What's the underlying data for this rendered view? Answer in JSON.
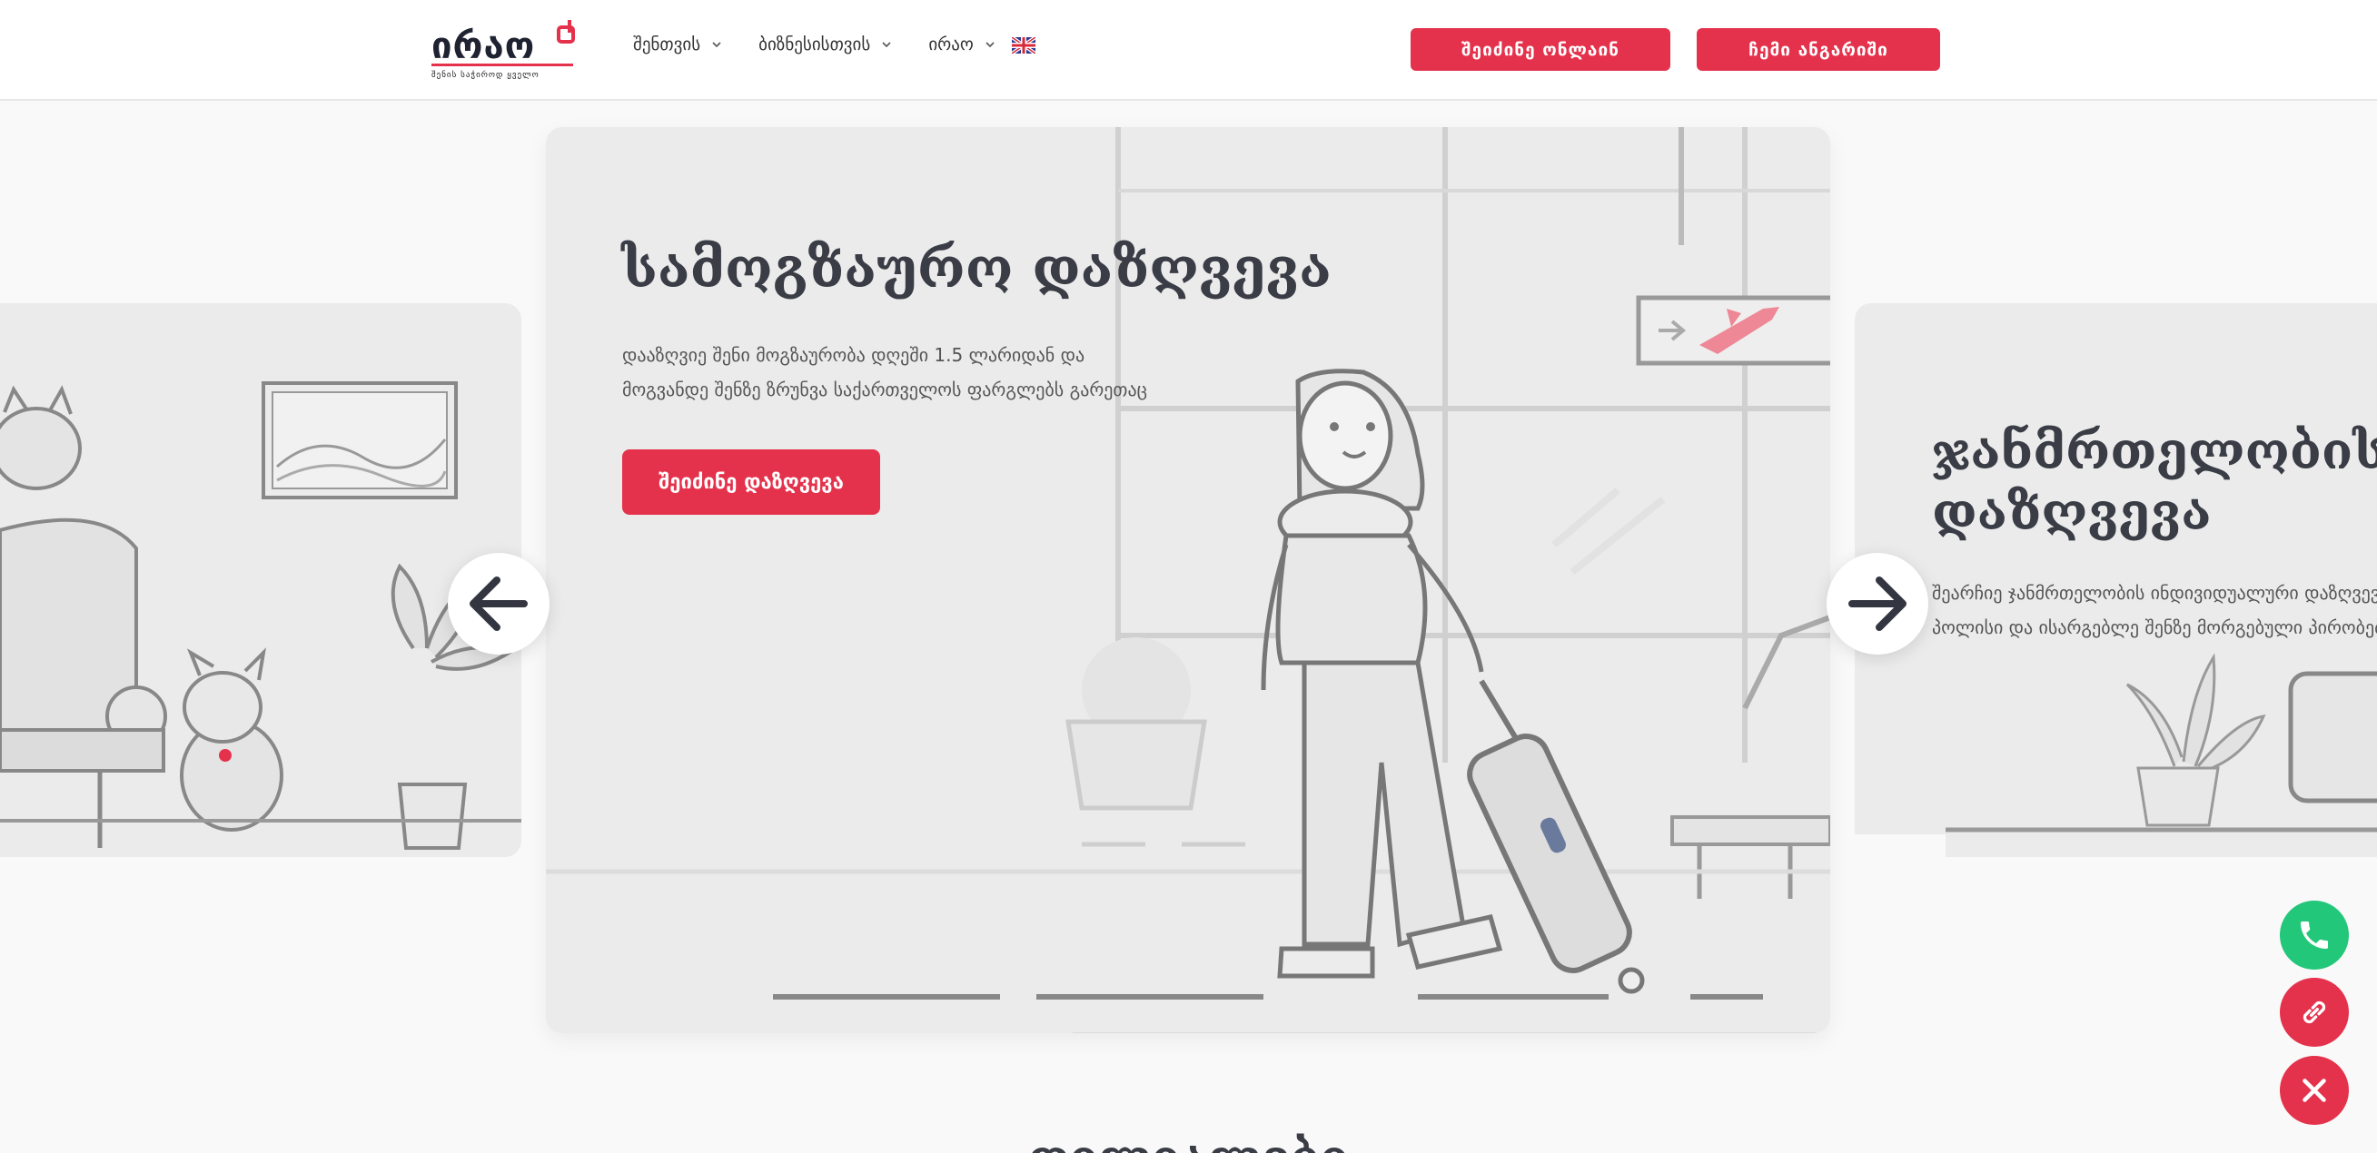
{
  "header": {
    "logo_text": "ირაო",
    "logo_tagline": "შენის საჭიროდ ყველო",
    "nav": [
      {
        "label": "შენთვის"
      },
      {
        "label": "ბიზნესისთვის"
      },
      {
        "label": "ირაო"
      }
    ],
    "language_flag": "uk-flag-icon",
    "buy_online_label": "შეიძინე ონლაინ",
    "my_account_label": "ჩემი ანგარიში"
  },
  "slides": {
    "prev": {
      "illustration": "living-room-with-cat-and-dog"
    },
    "current": {
      "title": "სამოგზაურო დაზღვევა",
      "text_line1": "დააზღვიე შენი მოგზაურობა დღეში 1.5 ლარიდან და",
      "text_line2": "მოგვანდე შენზე ზრუნვა საქართველოს ფარგლებს გარეთაც",
      "cta_label": "შეიძინე დაზღვევა",
      "illustration": "traveler-with-suitcase"
    },
    "next": {
      "title_line1": "ჯანმრთელობის",
      "title_line2": "დაზღვევა",
      "text_line1": "შეარჩიე ჯანმრთელობის ინდივიდუალური დაზღვევის",
      "text_line2": "პოლისი და ისარგებლე შენზე მორგებული პირობებით"
    }
  },
  "section_title": "ფილიალები",
  "colors": {
    "accent": "#e5324c",
    "phone_green": "#22c77a",
    "title": "#3a3d46"
  }
}
